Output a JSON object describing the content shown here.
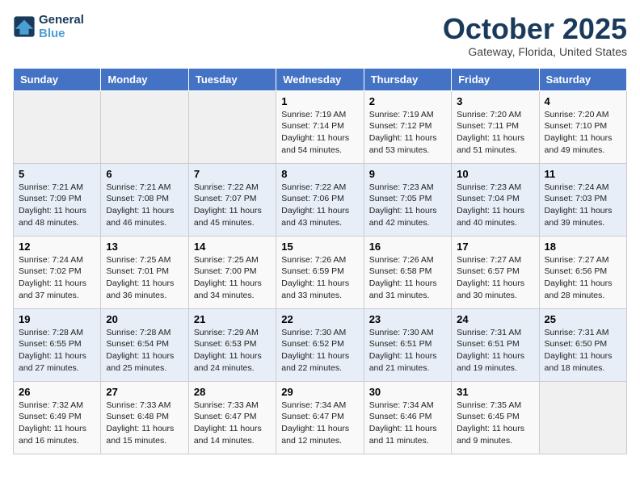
{
  "header": {
    "logo_line1": "General",
    "logo_line2": "Blue",
    "month_title": "October 2025",
    "location": "Gateway, Florida, United States"
  },
  "weekdays": [
    "Sunday",
    "Monday",
    "Tuesday",
    "Wednesday",
    "Thursday",
    "Friday",
    "Saturday"
  ],
  "weeks": [
    [
      {
        "day": "",
        "info": ""
      },
      {
        "day": "",
        "info": ""
      },
      {
        "day": "",
        "info": ""
      },
      {
        "day": "1",
        "info": "Sunrise: 7:19 AM\nSunset: 7:14 PM\nDaylight: 11 hours and 54 minutes."
      },
      {
        "day": "2",
        "info": "Sunrise: 7:19 AM\nSunset: 7:12 PM\nDaylight: 11 hours and 53 minutes."
      },
      {
        "day": "3",
        "info": "Sunrise: 7:20 AM\nSunset: 7:11 PM\nDaylight: 11 hours and 51 minutes."
      },
      {
        "day": "4",
        "info": "Sunrise: 7:20 AM\nSunset: 7:10 PM\nDaylight: 11 hours and 49 minutes."
      }
    ],
    [
      {
        "day": "5",
        "info": "Sunrise: 7:21 AM\nSunset: 7:09 PM\nDaylight: 11 hours and 48 minutes."
      },
      {
        "day": "6",
        "info": "Sunrise: 7:21 AM\nSunset: 7:08 PM\nDaylight: 11 hours and 46 minutes."
      },
      {
        "day": "7",
        "info": "Sunrise: 7:22 AM\nSunset: 7:07 PM\nDaylight: 11 hours and 45 minutes."
      },
      {
        "day": "8",
        "info": "Sunrise: 7:22 AM\nSunset: 7:06 PM\nDaylight: 11 hours and 43 minutes."
      },
      {
        "day": "9",
        "info": "Sunrise: 7:23 AM\nSunset: 7:05 PM\nDaylight: 11 hours and 42 minutes."
      },
      {
        "day": "10",
        "info": "Sunrise: 7:23 AM\nSunset: 7:04 PM\nDaylight: 11 hours and 40 minutes."
      },
      {
        "day": "11",
        "info": "Sunrise: 7:24 AM\nSunset: 7:03 PM\nDaylight: 11 hours and 39 minutes."
      }
    ],
    [
      {
        "day": "12",
        "info": "Sunrise: 7:24 AM\nSunset: 7:02 PM\nDaylight: 11 hours and 37 minutes."
      },
      {
        "day": "13",
        "info": "Sunrise: 7:25 AM\nSunset: 7:01 PM\nDaylight: 11 hours and 36 minutes."
      },
      {
        "day": "14",
        "info": "Sunrise: 7:25 AM\nSunset: 7:00 PM\nDaylight: 11 hours and 34 minutes."
      },
      {
        "day": "15",
        "info": "Sunrise: 7:26 AM\nSunset: 6:59 PM\nDaylight: 11 hours and 33 minutes."
      },
      {
        "day": "16",
        "info": "Sunrise: 7:26 AM\nSunset: 6:58 PM\nDaylight: 11 hours and 31 minutes."
      },
      {
        "day": "17",
        "info": "Sunrise: 7:27 AM\nSunset: 6:57 PM\nDaylight: 11 hours and 30 minutes."
      },
      {
        "day": "18",
        "info": "Sunrise: 7:27 AM\nSunset: 6:56 PM\nDaylight: 11 hours and 28 minutes."
      }
    ],
    [
      {
        "day": "19",
        "info": "Sunrise: 7:28 AM\nSunset: 6:55 PM\nDaylight: 11 hours and 27 minutes."
      },
      {
        "day": "20",
        "info": "Sunrise: 7:28 AM\nSunset: 6:54 PM\nDaylight: 11 hours and 25 minutes."
      },
      {
        "day": "21",
        "info": "Sunrise: 7:29 AM\nSunset: 6:53 PM\nDaylight: 11 hours and 24 minutes."
      },
      {
        "day": "22",
        "info": "Sunrise: 7:30 AM\nSunset: 6:52 PM\nDaylight: 11 hours and 22 minutes."
      },
      {
        "day": "23",
        "info": "Sunrise: 7:30 AM\nSunset: 6:51 PM\nDaylight: 11 hours and 21 minutes."
      },
      {
        "day": "24",
        "info": "Sunrise: 7:31 AM\nSunset: 6:51 PM\nDaylight: 11 hours and 19 minutes."
      },
      {
        "day": "25",
        "info": "Sunrise: 7:31 AM\nSunset: 6:50 PM\nDaylight: 11 hours and 18 minutes."
      }
    ],
    [
      {
        "day": "26",
        "info": "Sunrise: 7:32 AM\nSunset: 6:49 PM\nDaylight: 11 hours and 16 minutes."
      },
      {
        "day": "27",
        "info": "Sunrise: 7:33 AM\nSunset: 6:48 PM\nDaylight: 11 hours and 15 minutes."
      },
      {
        "day": "28",
        "info": "Sunrise: 7:33 AM\nSunset: 6:47 PM\nDaylight: 11 hours and 14 minutes."
      },
      {
        "day": "29",
        "info": "Sunrise: 7:34 AM\nSunset: 6:47 PM\nDaylight: 11 hours and 12 minutes."
      },
      {
        "day": "30",
        "info": "Sunrise: 7:34 AM\nSunset: 6:46 PM\nDaylight: 11 hours and 11 minutes."
      },
      {
        "day": "31",
        "info": "Sunrise: 7:35 AM\nSunset: 6:45 PM\nDaylight: 11 hours and 9 minutes."
      },
      {
        "day": "",
        "info": ""
      }
    ]
  ]
}
